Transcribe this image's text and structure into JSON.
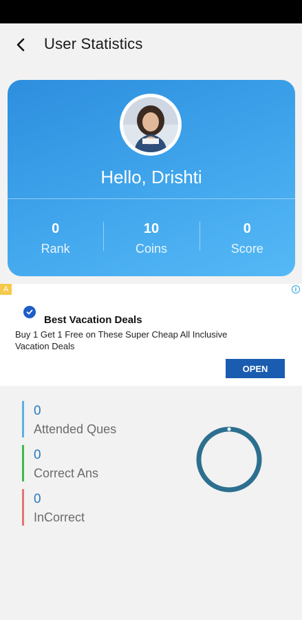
{
  "header": {
    "title": "User Statistics",
    "back_icon": "chevron-left-icon"
  },
  "profile": {
    "greeting": "Hello, Drishti",
    "stats": [
      {
        "value": "0",
        "label": "Rank"
      },
      {
        "value": "10",
        "label": "Coins"
      },
      {
        "value": "0",
        "label": "Score"
      }
    ],
    "colors": {
      "gradient_start": "#2d8ede",
      "gradient_end": "#55b9f6"
    }
  },
  "ad": {
    "badge": "A",
    "title": "Best Vacation Deals",
    "body": "Buy 1 Get 1 Free on These Super Cheap All Inclusive Vacation Deals",
    "button": "OPEN",
    "button_color": "#1a5cb0"
  },
  "metrics": [
    {
      "value": "0",
      "label": "Attended Ques",
      "color": "#5aaee6"
    },
    {
      "value": "0",
      "label": "Correct Ans",
      "color": "#3dbb4a"
    },
    {
      "value": "0",
      "label": "InCorrect",
      "color": "#e57373"
    }
  ],
  "progress_ring": {
    "fraction": 0,
    "color": "#2d6f8f"
  }
}
